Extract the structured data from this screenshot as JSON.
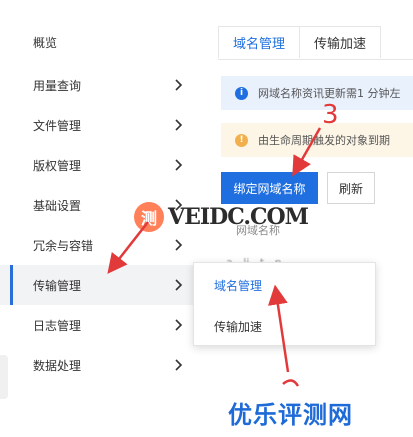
{
  "sidebar": {
    "items": [
      {
        "label": "概览",
        "has_chevron": false
      },
      {
        "label": "用量查询",
        "has_chevron": true
      },
      {
        "label": "文件管理",
        "has_chevron": true
      },
      {
        "label": "版权管理",
        "has_chevron": true
      },
      {
        "label": "基础设置",
        "has_chevron": true
      },
      {
        "label": "冗余与容错",
        "has_chevron": true
      },
      {
        "label": "传输管理",
        "has_chevron": true,
        "active": true
      },
      {
        "label": "日志管理",
        "has_chevron": true
      },
      {
        "label": "数据处理",
        "has_chevron": true
      }
    ]
  },
  "flyout": {
    "items": [
      {
        "label": "域名管理",
        "active": true
      },
      {
        "label": "传输加速",
        "active": false
      }
    ]
  },
  "main": {
    "tabs": [
      {
        "label": "域名管理",
        "active": true
      },
      {
        "label": "传输加速",
        "active": false
      }
    ],
    "info_banner": "网域名称资讯更新需1 分钟左",
    "warn_banner": "由生命周期触发的对象到期",
    "bind_button": "绑定网域名称",
    "refresh_button": "刷新",
    "column_header": "网域名称",
    "blurred_row": "a...li...t...n..."
  },
  "annotations": {
    "step_number": "3",
    "arrow_color": "#e23a3a"
  },
  "watermark": {
    "site": "VEIDC.COM",
    "logo_glyph": "测",
    "corner": "优乐评测网"
  },
  "colors": {
    "accent": "#1f6fe0",
    "info_bg": "#e9f1fd",
    "warn_bg": "#fdf6e7",
    "annotation": "#e23a3a"
  }
}
